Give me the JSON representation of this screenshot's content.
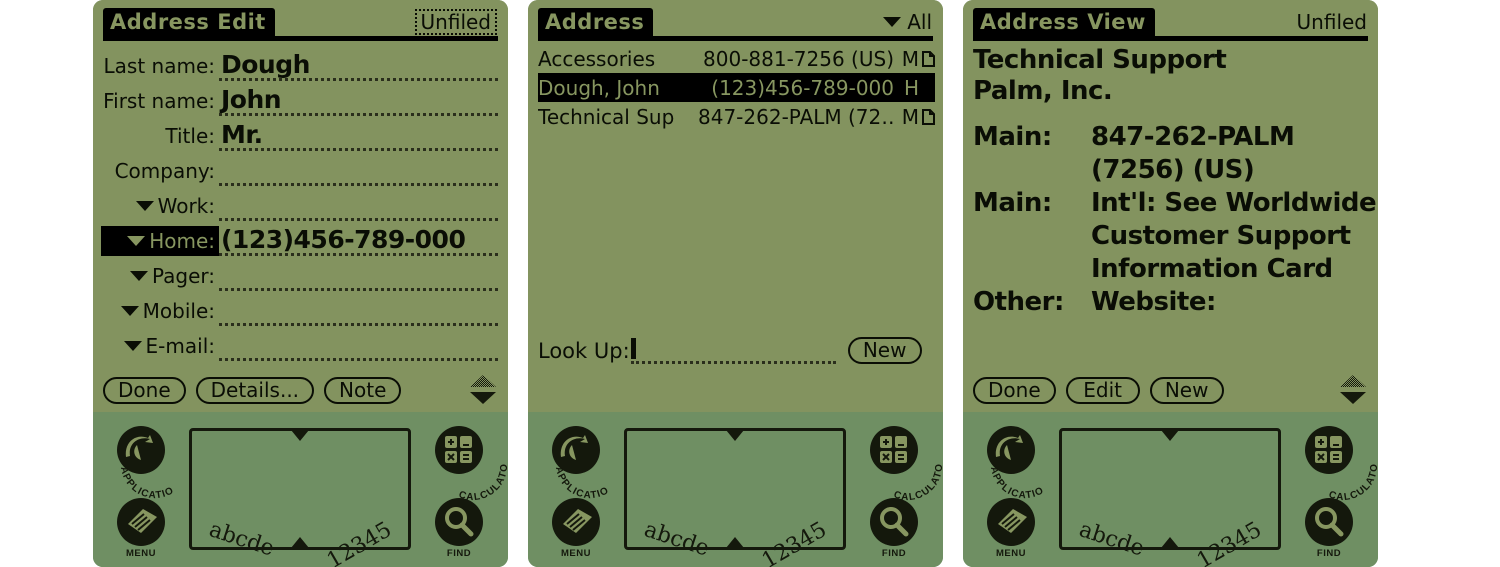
{
  "colors": {
    "lcd_background": "#83935f",
    "case_background": "#6f8f63",
    "ink": "#0a0d05",
    "inverse_text": "#879660",
    "page_background": "#ffffff"
  },
  "devices": [
    {
      "id": "address-edit",
      "title": "Address Edit",
      "category": "Unfiled",
      "category_editable": true,
      "fields": [
        {
          "label": "Last name:",
          "value": "Dough",
          "has_dropdown": false,
          "selected": false
        },
        {
          "label": "First name:",
          "value": "John",
          "has_dropdown": false,
          "selected": false
        },
        {
          "label": "Title:",
          "value": "Mr.",
          "has_dropdown": false,
          "selected": false
        },
        {
          "label": "Company:",
          "value": "",
          "has_dropdown": false,
          "selected": false
        },
        {
          "label": "Work:",
          "value": "",
          "has_dropdown": true,
          "selected": false
        },
        {
          "label": "Home:",
          "value": "(123)456-789-000",
          "has_dropdown": true,
          "selected": true
        },
        {
          "label": "Pager:",
          "value": "",
          "has_dropdown": true,
          "selected": false
        },
        {
          "label": "Mobile:",
          "value": "",
          "has_dropdown": true,
          "selected": false
        },
        {
          "label": "E-mail:",
          "value": "",
          "has_dropdown": true,
          "selected": false
        }
      ],
      "buttons": [
        "Done",
        "Details...",
        "Note"
      ]
    },
    {
      "id": "address-list",
      "title": "Address",
      "category": "All",
      "category_dropdown": true,
      "rows": [
        {
          "name": "Accessories",
          "phone": "800-881-7256 (US)",
          "type": "M",
          "note": true,
          "selected": false
        },
        {
          "name": "Dough, John",
          "phone": "(123)456-789-000",
          "type": "H",
          "note": false,
          "selected": true
        },
        {
          "name": "Technical Sup",
          "phone": "847-262-PALM (72…",
          "type": "M",
          "note": true,
          "selected": false
        }
      ],
      "lookup_label": "Look Up:",
      "lookup_value": "",
      "buttons": [
        "New"
      ]
    },
    {
      "id": "address-view",
      "title": "Address View",
      "category": "Unfiled",
      "category_editable": false,
      "header_lines": [
        "Technical Support",
        "Palm, Inc."
      ],
      "rows": [
        {
          "label": "Main:",
          "lines": [
            "847-262-PALM",
            "(7256) (US)"
          ]
        },
        {
          "label": "Main:",
          "lines": [
            "Int'l: See Worldwide",
            "Customer Support",
            "Information Card"
          ]
        },
        {
          "label": "Other:",
          "lines": [
            "Website:"
          ]
        }
      ],
      "buttons": [
        "Done",
        "Edit",
        "New"
      ]
    }
  ],
  "silkscreen": {
    "icons": [
      {
        "name": "applications",
        "label": "APPLICATIONS"
      },
      {
        "name": "menu",
        "label": "MENU"
      },
      {
        "name": "calculator",
        "label": "CALCULATOR"
      },
      {
        "name": "find",
        "label": "FIND"
      }
    ],
    "graffiti": {
      "letters": "abcde",
      "numbers": "12345"
    }
  }
}
